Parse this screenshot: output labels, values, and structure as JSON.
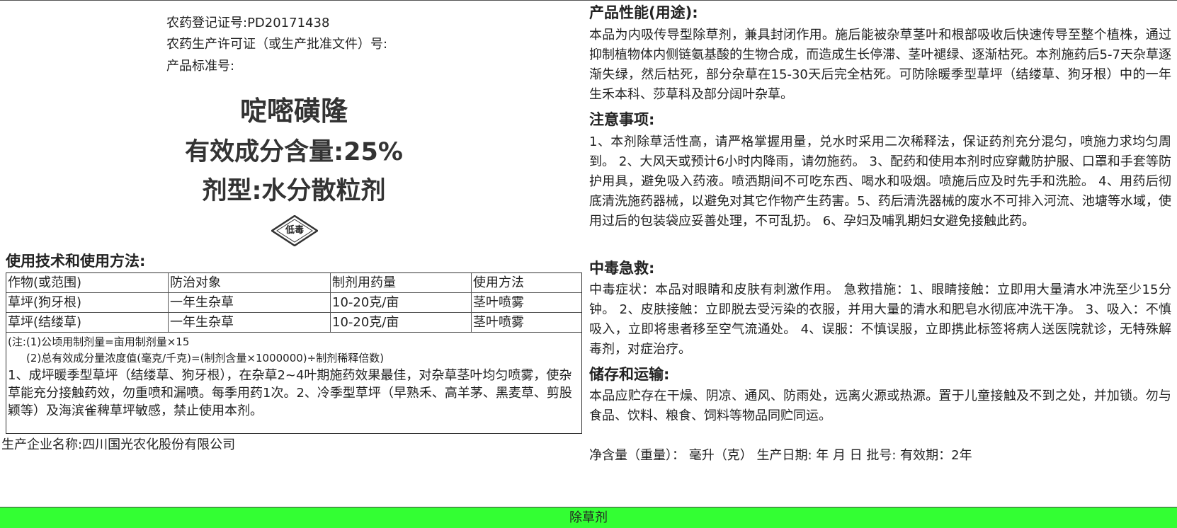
{
  "label": {
    "registration_no": "农药登记证号:PD20171438",
    "license_no": "农药生产许可证（或生产批准文件）号:",
    "standard_no": "产品标准号:",
    "product_name": "啶嘧磺隆",
    "content": "有效成分含量:25%",
    "formulation": "剂型:水分散粒剂",
    "toxicity_badge": "低毒",
    "usage_heading": "使用技术和使用方法:",
    "table": {
      "headers": [
        "作物(或范围)",
        "防治对象",
        "制剂用药量",
        "使用方法"
      ],
      "rows": [
        [
          "草坪(狗牙根)",
          "一年生杂草",
          "10-20克/亩",
          "茎叶喷雾"
        ],
        [
          "草坪(结缕草)",
          "一年生杂草",
          "10-20克/亩",
          "茎叶喷雾"
        ]
      ]
    },
    "note1": "(注:(1)公顷用制剂量=亩用制剂量×15",
    "note2": "(2)总有效成分量浓度值(毫克/千克)=(制剂含量×1000000)÷制剂稀释倍数)",
    "usage_text": "1、成坪暖季型草坪（结缕草、狗牙根），在杂草2~4叶期施药效果最佳，对杂草茎叶均匀喷雾，使杂草能充分接触药效，勿重喷和漏喷。每季用药1次。2、冷季型草坪（早熟禾、高羊茅、黑麦草、剪股颖等）及海滨雀稗草坪敏感，禁止使用本剂。",
    "manufacturer": "生产企业名称:四川国光农化股份有限公司"
  },
  "right": {
    "performance_heading": "产品性能(用途):",
    "performance_text": "本品为内吸传导型除草剂，兼具封闭作用。施后能被杂草茎叶和根部吸收后快速传导至整个植株，通过抑制植物体内侧链氨基酸的生物合成，而造成生长停滞、茎叶褪绿、逐渐枯死。本剂施药后5-7天杂草逐渐失绿，然后枯死，部分杂草在15-30天后完全枯死。可防除暖季型草坪（结缕草、狗牙根）中的一年生禾本科、莎草科及部分阔叶杂草。",
    "caution_heading": "注意事项:",
    "caution_text": "1、本剂除草活性高，请严格掌握用量，兑水时采用二次稀释法，保证药剂充分混匀，喷施力求均匀周到。 2、大风天或预计6小时内降雨，请勿施药。 3、配药和使用本剂时应穿戴防护服、口罩和手套等防护用具，避免吸入药液。喷洒期间不可吃东西、喝水和吸烟。喷施后应及时先手和洗脸。 4、用药后彻底清洗施药器械，以避免对其它作物产生药害。5、药后清洗器械的废水不可排入河流、池塘等水域，使用过后的包装袋应妥善处理，不可乱扔。 6、孕妇及哺乳期妇女避免接触此药。",
    "firstaid_heading": "中毒急救:",
    "firstaid_text": "中毒症状：本品对眼睛和皮肤有刺激作用。 急救措施：1、眼睛接触：立即用大量清水冲洗至少15分钟。 2、皮肤接触：立即脱去受污染的衣服，并用大量的清水和肥皂水彻底冲洗干净。 3、吸入：不慎吸入，立即将患者移至空气流通处。 4、误服：不慎误服，立即携此标签将病人送医院就诊，无特殊解毒剂，对症治疗。",
    "storage_heading": "储存和运输:",
    "storage_text": "本品应贮存在干燥、阴凉、通风、防雨处，远离火源或热源。置于儿童接触及不到之处，并加锁。勿与食品、饮料、粮食、饲料等物品同贮同运。",
    "net_line": "净含量（重量）：  毫升（克）  生产日期: 年  月  日  批号:  有效期：2年"
  },
  "footer": {
    "category": "除草剂"
  },
  "colors": {
    "footer_bg": "#33ff33",
    "text": "#222222"
  }
}
